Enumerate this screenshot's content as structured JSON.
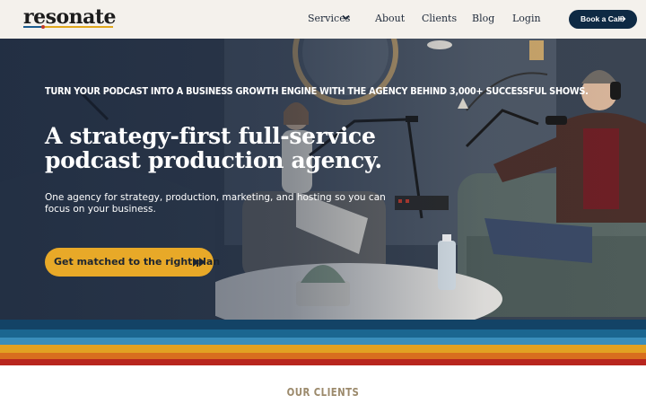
{
  "brand": {
    "logo_text": "resonate",
    "colors": {
      "navy": "#0e2a44",
      "gold": "#e8a928",
      "cream": "#f4f1ec",
      "red": "#c0392b",
      "blue": "#1b5c8f"
    }
  },
  "nav": {
    "items": [
      {
        "label": "Services",
        "has_dropdown": true,
        "icon": "chevron-down-icon"
      },
      {
        "label": "About"
      },
      {
        "label": "Clients"
      },
      {
        "label": "Blog"
      },
      {
        "label": "Login"
      }
    ],
    "cta": {
      "label": "Book a Call",
      "icon": "arrow-right-icon"
    }
  },
  "hero": {
    "tagline": "TURN YOUR PODCAST INTO A BUSINESS GROWTH ENGINE WITH THE AGENCY BEHIND 3,000+ SUCCESSFUL SHOWS.",
    "headline_line1": "A strategy-first full-service",
    "headline_line2": "podcast production agency.",
    "subtext": "One agency for strategy, production, marketing, and hosting so you can focus on your business.",
    "cta": {
      "label": "Get matched to the right plan",
      "icon": "fast-forward-icon"
    }
  },
  "stripes": {
    "colors": [
      "#134366",
      "#1b6690",
      "#3a8dba",
      "#e2a122",
      "#d86e1e",
      "#b8261e"
    ]
  },
  "clients": {
    "heading": "OUR CLIENTS"
  }
}
